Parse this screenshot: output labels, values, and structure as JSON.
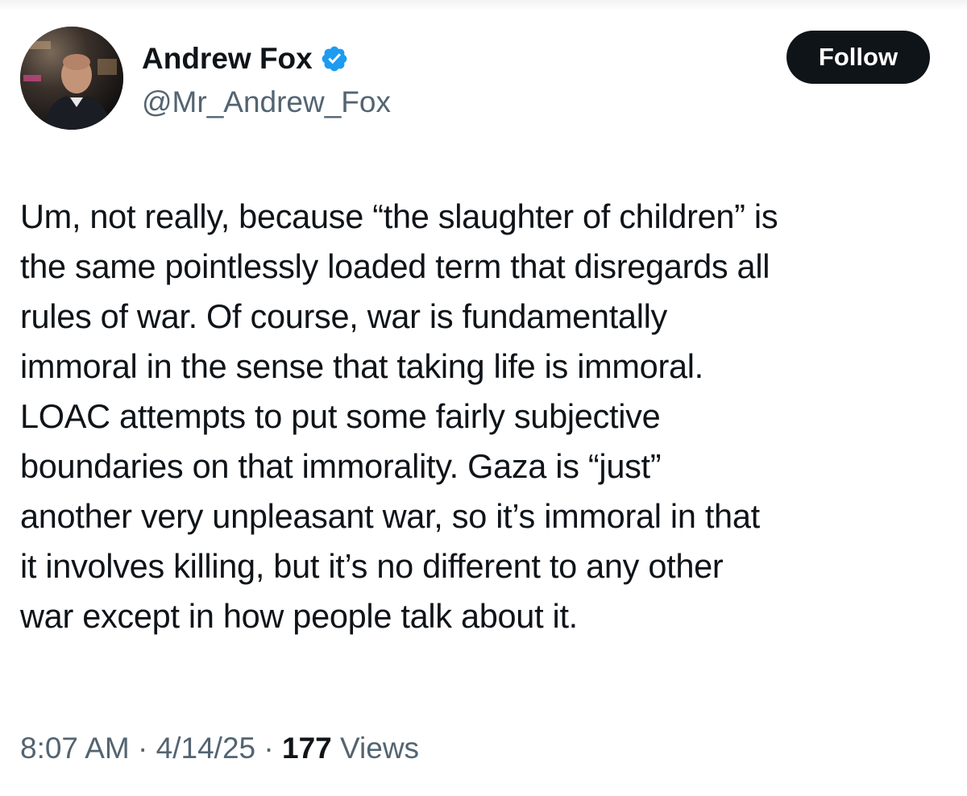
{
  "author": {
    "display_name": "Andrew Fox",
    "handle": "@Mr_Andrew_Fox",
    "verified": true,
    "verified_color": "#1d9bf0"
  },
  "follow_button": {
    "label": "Follow",
    "background": "#0f1419",
    "text_color": "#ffffff"
  },
  "tweet": {
    "lines": [
      "Um, not really, because “the slaughter of children” is",
      "the same pointlessly loaded term that disregards all",
      "rules of war. Of course, war is fundamentally",
      "immoral in the sense that taking life is immoral.",
      "LOAC attempts to put some fairly subjective",
      "boundaries on that immorality. Gaza is “just”",
      "another very unpleasant war, so it’s immoral in that",
      "it involves killing, but it’s no different to any other",
      "war except in how people talk about it."
    ]
  },
  "meta": {
    "time": "8:07 AM",
    "separator": "·",
    "date": "4/14/25",
    "views_count": "177",
    "views_label": "Views"
  },
  "icons": {
    "verified": "verified-badge-icon"
  }
}
